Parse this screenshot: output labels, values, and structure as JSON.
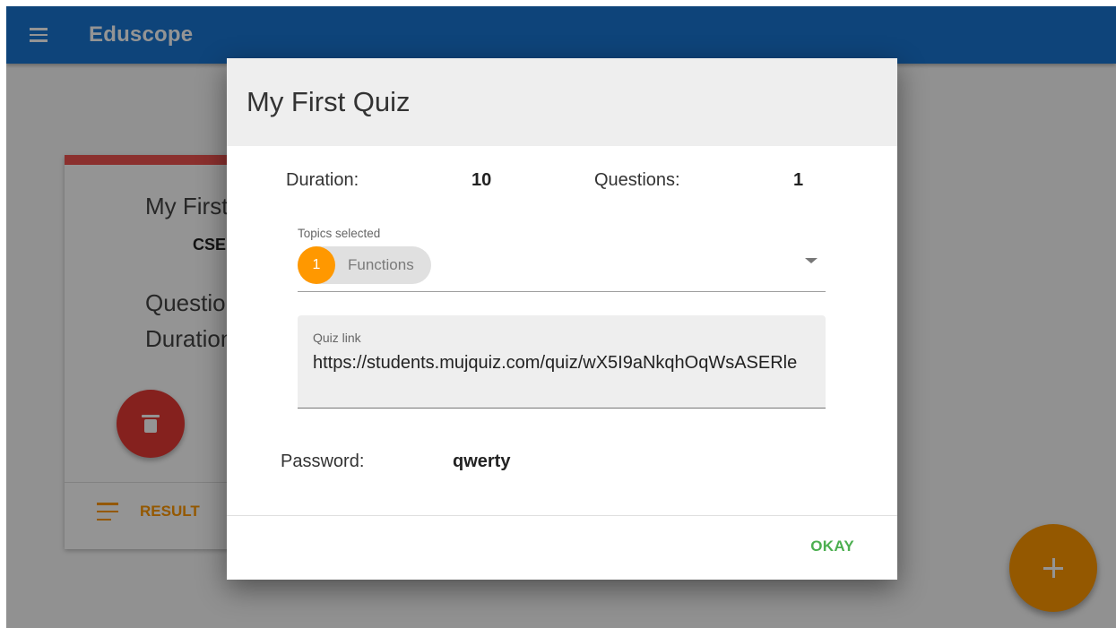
{
  "app": {
    "title": "Eduscope",
    "bar_color": "#1976d2"
  },
  "card": {
    "title": "My First Quiz",
    "subject": "CSE",
    "questions_label": "Questions",
    "duration_label": "Duration",
    "result_label": "RESULT",
    "accent_color": "#ef5350"
  },
  "dialog": {
    "title": "My First Quiz",
    "duration_label": "Duration:",
    "duration_value": "10",
    "questions_label": "Questions:",
    "questions_value": "1",
    "topics": {
      "label": "Topics selected",
      "chips": [
        {
          "avatar": "1",
          "text": "Functions"
        }
      ]
    },
    "quiz_link": {
      "label": "Quiz link",
      "value": "https://students.mujquiz.com/quiz/wX5I9aNkqhOqWsASERle"
    },
    "password_label": "Password:",
    "password_value": "qwerty",
    "okay_label": "OKAY"
  },
  "icons": {
    "menu": "menu-icon",
    "delete": "trash-icon",
    "result": "list-lines-icon",
    "add": "plus-icon",
    "dropdown": "chevron-down-icon"
  },
  "colors": {
    "accent": "#ff9800",
    "danger": "#e53935",
    "success": "#4caf50"
  }
}
